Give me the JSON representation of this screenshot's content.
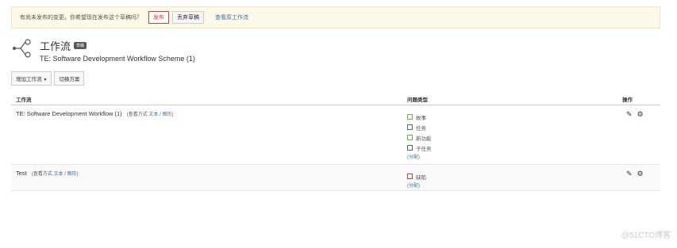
{
  "notice": {
    "message": "有尚未发布的变更。你希望现在发布这个草稿吗？",
    "publish_label": "发布",
    "discard_label": "丢弃草稿",
    "view_original_label": "查看原工作流"
  },
  "header": {
    "title": "工作流",
    "badge": "草稿",
    "scheme_name": "TE: Software Development Workflow Scheme (1)"
  },
  "actions": {
    "add_workflow_label": "增加工作流",
    "switch_scheme_label": "切换方案"
  },
  "table": {
    "columns": [
      "工作流",
      "问题类型",
      "操作"
    ],
    "rows": [
      {
        "workflow": "TE: Software Development Workflow (1)",
        "view_prefix": "(查看方式",
        "view_text": "文本",
        "view_sep": "/",
        "view_graph": "图形",
        "view_suffix": ")",
        "issue_types": [
          {
            "name": "故事",
            "icon": "story-icon",
            "color": "#63ba3c"
          },
          {
            "name": "任务",
            "icon": "task-icon",
            "color": "#4a6785"
          },
          {
            "name": "新功能",
            "icon": "new-feature-icon",
            "color": "#63ba3c"
          },
          {
            "name": "子任务",
            "icon": "subtask-icon",
            "color": "#4a6785"
          }
        ],
        "assign_label": "(分配)"
      },
      {
        "workflow": "Test",
        "view_prefix": "(查看方式",
        "view_text": "文本",
        "view_sep": "/",
        "view_graph": "图形",
        "view_suffix": ")",
        "issue_types": [
          {
            "name": "缺陷",
            "icon": "bug-icon",
            "color": "#d04437"
          }
        ],
        "assign_label": "(分配)"
      }
    ]
  },
  "watermark": "@51CTO博客"
}
